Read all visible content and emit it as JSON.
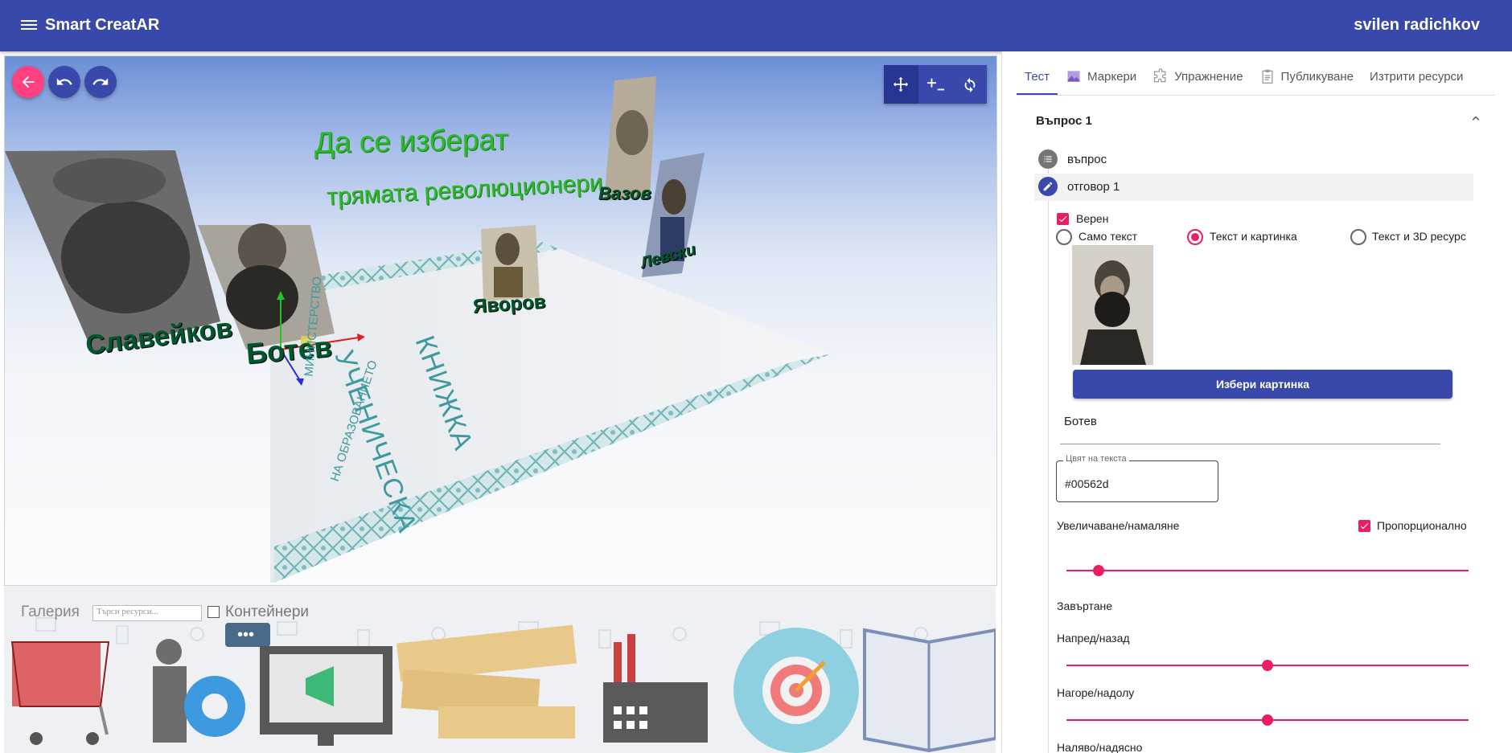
{
  "app": {
    "title": "Smart CreatAR",
    "user": "svilen radichkov"
  },
  "scene": {
    "texts": {
      "title1": "Да се изберат",
      "title2": "трямата революционери",
      "book1": "УЧЕНИЧЕСКА",
      "book2": "КНИЖКА",
      "ministry1": "МИНИСТЕРСТВО",
      "ministry2": "НА ОБРАЗОВАНИЕТО"
    },
    "labels": {
      "slaveykov": "Славейков",
      "botev": "Ботев",
      "yavorov": "Яворов",
      "vazov": "Вазов",
      "levski": "Левски"
    }
  },
  "gallery": {
    "label": "Галерия",
    "search_placeholder": "Търси ресурси...",
    "containers": "Контейнери"
  },
  "tabs": [
    {
      "label": "Тест",
      "icon": "none"
    },
    {
      "label": "Маркери",
      "icon": "image-icon"
    },
    {
      "label": "Упражнение",
      "icon": "puzzle-icon"
    },
    {
      "label": "Публикуване",
      "icon": "clipboard-icon"
    },
    {
      "label": "Изтрити ресурси",
      "icon": "none"
    }
  ],
  "question": {
    "title": "Въпрос 1",
    "step_question": "въпрос",
    "step_answer": "отговор 1",
    "correct_label": "Верен",
    "type_options": [
      "Само текст",
      "Текст и картинка",
      "Текст и 3D ресурс"
    ],
    "type_selected": "Текст и картинка",
    "choose_image": "Избери картинка",
    "answer_text": "Ботев",
    "text_color_label": "Цвят на текста",
    "text_color": "#00562d",
    "scale_label": "Увеличаване/намаляне",
    "proportional_label": "Пропорционално",
    "scale_value": 0.08,
    "rotation_label": "Завъртане",
    "forward_label": "Напред/назад",
    "forward_value": 0.5,
    "updown_label": "Нагоре/надолу",
    "updown_value": 0.5,
    "leftright_label": "Наляво/надясно"
  },
  "colors": {
    "primary": "#3949ab",
    "accent": "#e91e63",
    "scene_text_green": "#2eb82e",
    "label_dark_green": "#00562d"
  }
}
